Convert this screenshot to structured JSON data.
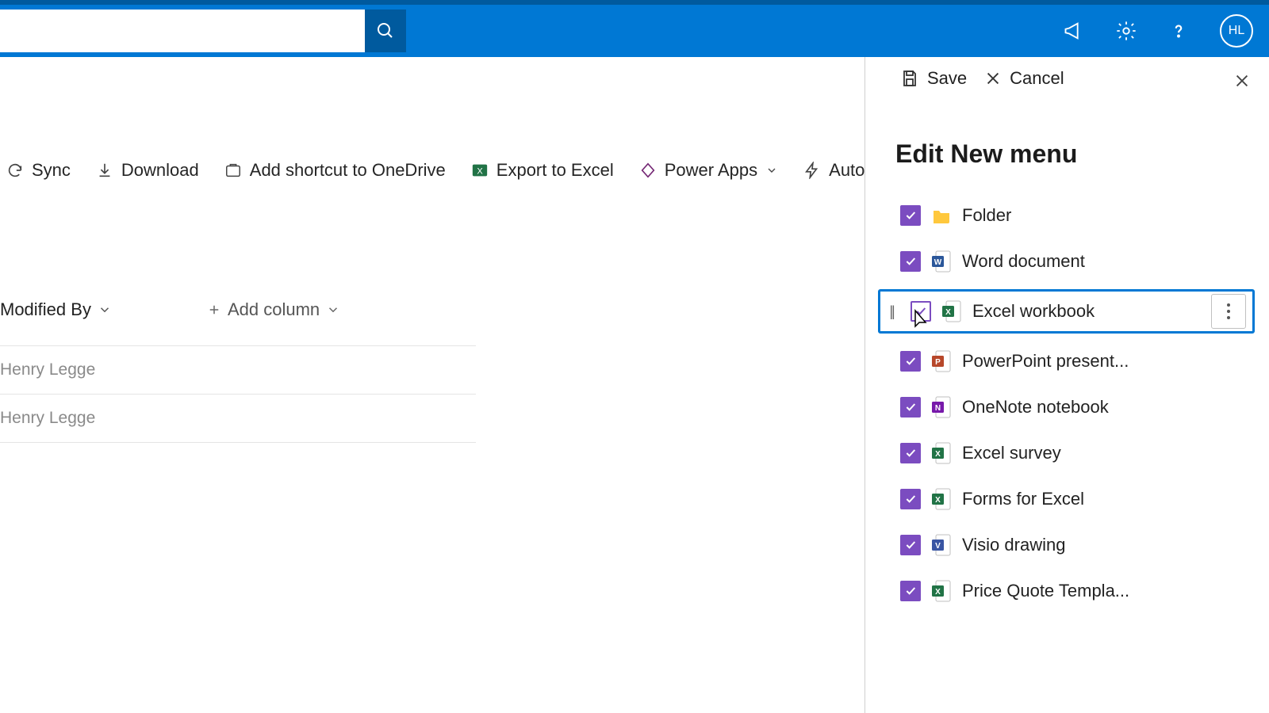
{
  "header": {
    "search_placeholder": "",
    "avatar_initials": "HL"
  },
  "commandBar": {
    "sync": "Sync",
    "download": "Download",
    "addShortcut": "Add shortcut to OneDrive",
    "exportExcel": "Export to Excel",
    "powerApps": "Power Apps",
    "automate": "Automate"
  },
  "columns": {
    "modifiedBy": "Modified By",
    "addColumn": "Add column"
  },
  "rows": [
    "Henry Legge",
    "Henry Legge"
  ],
  "panel": {
    "save": "Save",
    "cancel": "Cancel",
    "title": "Edit New menu",
    "items": [
      {
        "label": "Folder",
        "icon": "folder",
        "checked": true,
        "highlight": false
      },
      {
        "label": "Word document",
        "icon": "word",
        "checked": true,
        "highlight": false
      },
      {
        "label": "Excel workbook",
        "icon": "excel",
        "checked": true,
        "highlight": true
      },
      {
        "label": "PowerPoint present...",
        "icon": "ppt",
        "checked": true,
        "highlight": false
      },
      {
        "label": "OneNote notebook",
        "icon": "onenote",
        "checked": true,
        "highlight": false
      },
      {
        "label": "Excel survey",
        "icon": "excel",
        "checked": true,
        "highlight": false
      },
      {
        "label": "Forms for Excel",
        "icon": "excel",
        "checked": true,
        "highlight": false
      },
      {
        "label": "Visio drawing",
        "icon": "visio",
        "checked": true,
        "highlight": false
      },
      {
        "label": "Price Quote Templa...",
        "icon": "excel",
        "checked": true,
        "highlight": false
      }
    ]
  },
  "iconColors": {
    "folder": "#ffc83d",
    "word": "#2b579a",
    "excel": "#217346",
    "ppt": "#b7472a",
    "onenote": "#7719aa",
    "visio": "#3955a3"
  }
}
